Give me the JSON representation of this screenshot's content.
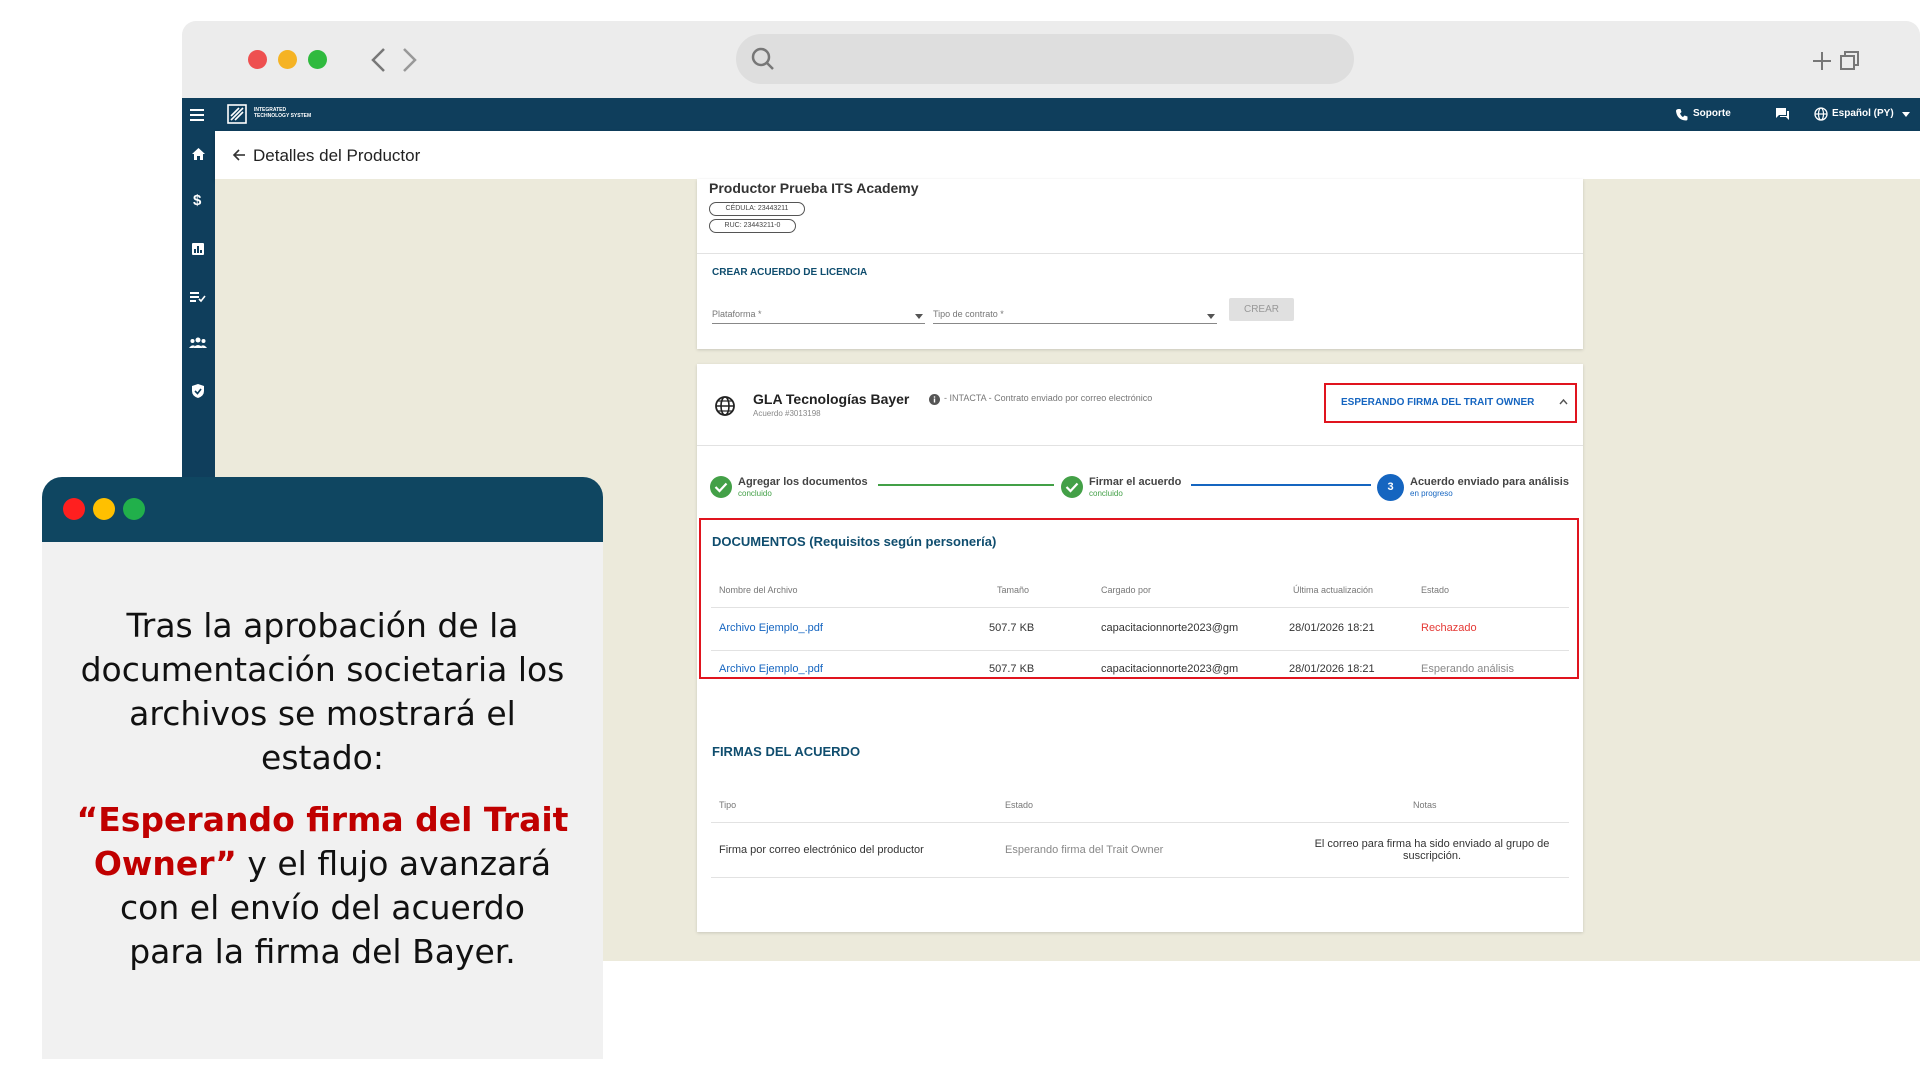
{
  "app": {
    "logo_line1": "INTEGRATED",
    "logo_line2": "TECHNOLOGY SYSTEM",
    "support_label": "Soporte",
    "language_label": "Español (PY)",
    "page_title": "Detalles del Productor"
  },
  "producer": {
    "name": "Productor Prueba ITS Academy",
    "cedula": "CÉDULA: 23443211",
    "ruc": "RUC: 23443211-0"
  },
  "license_form": {
    "section_title": "CREAR ACUERDO DE LICENCIA",
    "platform_label": "Plataforma *",
    "contract_type_label": "Tipo de contrato *",
    "create_button": "CREAR"
  },
  "agreement": {
    "title": "GLA Tecnologías Bayer",
    "subtitle": "- INTACTA - Contrato enviado por correo electrónico",
    "agreement_number": "Acuerdo #3013198",
    "status_label": "ESPERANDO FIRMA DEL TRAIT OWNER",
    "steps": [
      {
        "label": "Agregar los documentos",
        "status": "concluido"
      },
      {
        "label": "Firmar el acuerdo",
        "status": "concluido"
      },
      {
        "number": "3",
        "label": "Acuerdo enviado para análisis",
        "status": "en progreso"
      }
    ]
  },
  "documents": {
    "section_title": "DOCUMENTOS (Requisitos según personería)",
    "columns": [
      "Nombre del Archivo",
      "Tamaño",
      "Cargado por",
      "Última actualización",
      "Estado"
    ],
    "rows": [
      {
        "name": "Archivo Ejemplo_.pdf",
        "size": "507.7 KB",
        "uploaded_by": "capacitacionnorte2023@gm",
        "updated": "28/01/2026 18:21",
        "status": "Rechazado"
      },
      {
        "name": "Archivo Ejemplo_.pdf",
        "size": "507.7 KB",
        "uploaded_by": "capacitacionnorte2023@gm",
        "updated": "28/01/2026 18:21",
        "status": "Esperando análisis"
      }
    ]
  },
  "signatures": {
    "section_title": "FIRMAS DEL ACUERDO",
    "columns": [
      "Tipo",
      "Estado",
      "Notas"
    ],
    "rows": [
      {
        "type": "Firma por correo electrónico del productor",
        "status": "Esperando firma del Trait Owner",
        "notes_line1": "El correo para firma ha sido enviado al grupo de",
        "notes_line2": "suscripción."
      }
    ]
  },
  "overlay": {
    "line1": "Tras la aprobación de la",
    "line2": "documentación societaria los",
    "line3": "archivos se mostrará el",
    "line4": "estado:",
    "highlight1": "“Esperando firma del Trait",
    "highlight2": "Owner”",
    "line5_rest": " y el flujo avanzará",
    "line6": "con el envío del acuerdo",
    "line7": "para  la firma del Bayer."
  },
  "colors": {
    "brand_dark": "#0f3e5c",
    "accent_blue": "#1565c0",
    "success_green": "#43a047",
    "error_red": "#e53935",
    "highlight_red": "#c00000",
    "content_bg": "#eceadb"
  }
}
